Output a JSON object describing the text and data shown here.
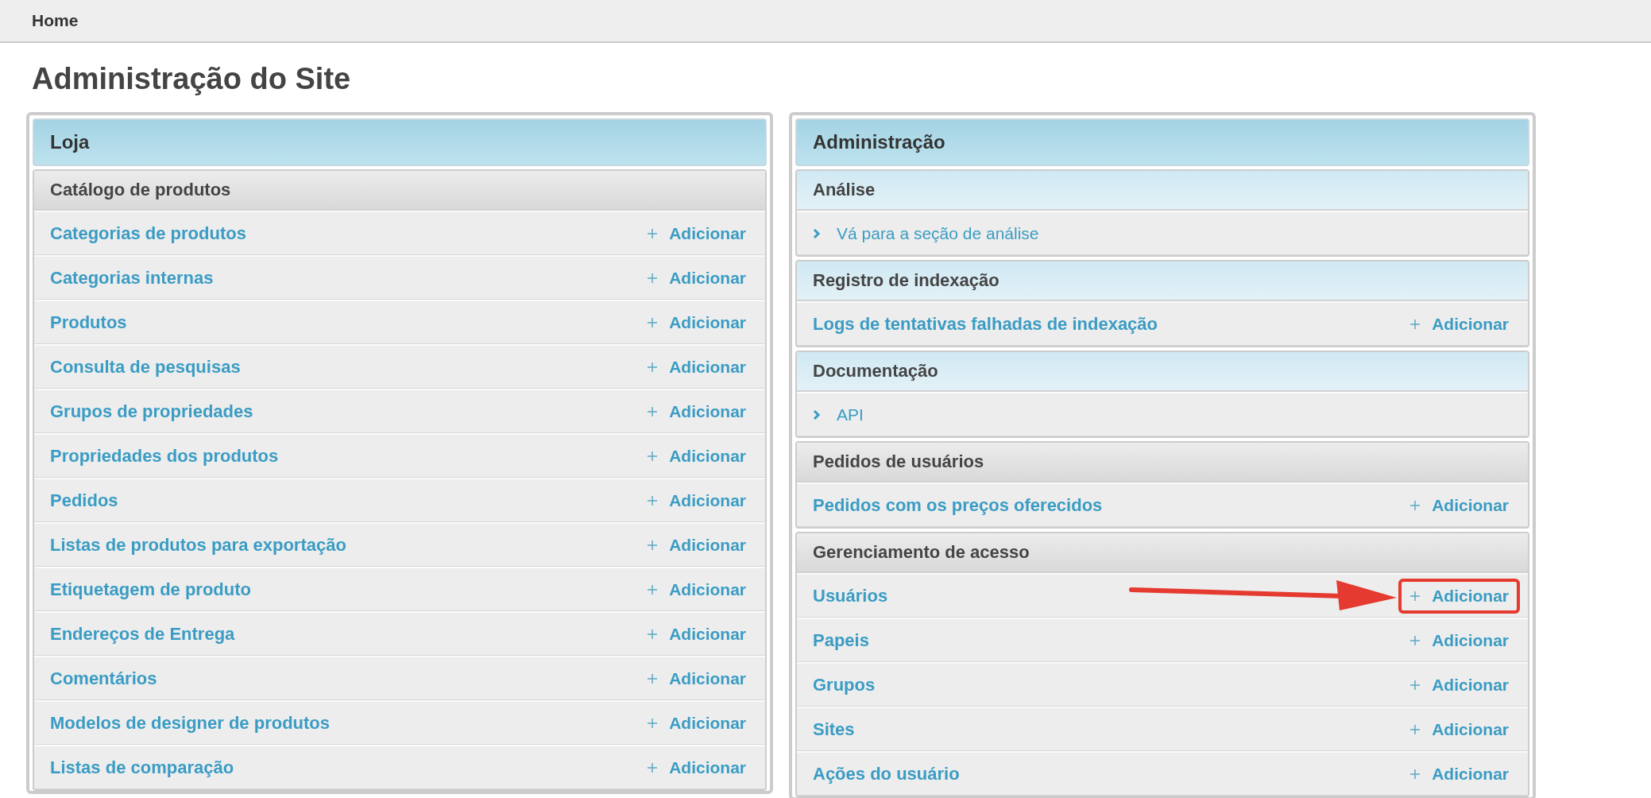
{
  "breadcrumb": {
    "label": "Home"
  },
  "title": "Administração do Site",
  "panels": [
    {
      "title": "Loja",
      "sections": [
        {
          "title": "Catálogo de produtos",
          "highlighted": false,
          "rows": [
            {
              "kind": "model",
              "label": "Categorias de produtos",
              "action": "Adicionar",
              "annotated": false
            },
            {
              "kind": "model",
              "label": "Categorias internas",
              "action": "Adicionar",
              "annotated": false
            },
            {
              "kind": "model",
              "label": "Produtos",
              "action": "Adicionar",
              "annotated": false
            },
            {
              "kind": "model",
              "label": "Consulta de pesquisas",
              "action": "Adicionar",
              "annotated": false
            },
            {
              "kind": "model",
              "label": "Grupos de propriedades",
              "action": "Adicionar",
              "annotated": false
            },
            {
              "kind": "model",
              "label": "Propriedades dos produtos",
              "action": "Adicionar",
              "annotated": false
            },
            {
              "kind": "model",
              "label": "Pedidos",
              "action": "Adicionar",
              "annotated": false
            },
            {
              "kind": "model",
              "label": "Listas de produtos para exportação",
              "action": "Adicionar",
              "annotated": false
            },
            {
              "kind": "model",
              "label": "Etiquetagem de produto",
              "action": "Adicionar",
              "annotated": false
            },
            {
              "kind": "model",
              "label": "Endereços de Entrega",
              "action": "Adicionar",
              "annotated": false
            },
            {
              "kind": "model",
              "label": "Comentários",
              "action": "Adicionar",
              "annotated": false
            },
            {
              "kind": "model",
              "label": "Modelos de designer de produtos",
              "action": "Adicionar",
              "annotated": false
            },
            {
              "kind": "model",
              "label": "Listas de comparação",
              "action": "Adicionar",
              "annotated": false
            }
          ]
        }
      ]
    },
    {
      "title": "Administração",
      "sections": [
        {
          "title": "Análise",
          "highlighted": true,
          "rows": [
            {
              "kind": "link",
              "label": "Vá para a seção de análise"
            }
          ]
        },
        {
          "title": "Registro de indexação",
          "highlighted": true,
          "rows": [
            {
              "kind": "model",
              "label": "Logs de tentativas falhadas de indexação",
              "action": "Adicionar",
              "annotated": false
            }
          ]
        },
        {
          "title": "Documentação",
          "highlighted": true,
          "rows": [
            {
              "kind": "link",
              "label": "API"
            }
          ]
        },
        {
          "title": "Pedidos de usuários",
          "highlighted": false,
          "rows": [
            {
              "kind": "model",
              "label": "Pedidos com os preços oferecidos",
              "action": "Adicionar",
              "annotated": false
            }
          ]
        },
        {
          "title": "Gerenciamento de acesso",
          "highlighted": false,
          "rows": [
            {
              "kind": "model",
              "label": "Usuários",
              "action": "Adicionar",
              "annotated": true
            },
            {
              "kind": "model",
              "label": "Papeis",
              "action": "Adicionar",
              "annotated": false
            },
            {
              "kind": "model",
              "label": "Grupos",
              "action": "Adicionar",
              "annotated": false
            },
            {
              "kind": "model",
              "label": "Sites",
              "action": "Adicionar",
              "annotated": false
            },
            {
              "kind": "model",
              "label": "Ações do usuário",
              "action": "Adicionar",
              "annotated": false
            }
          ]
        }
      ]
    }
  ]
}
